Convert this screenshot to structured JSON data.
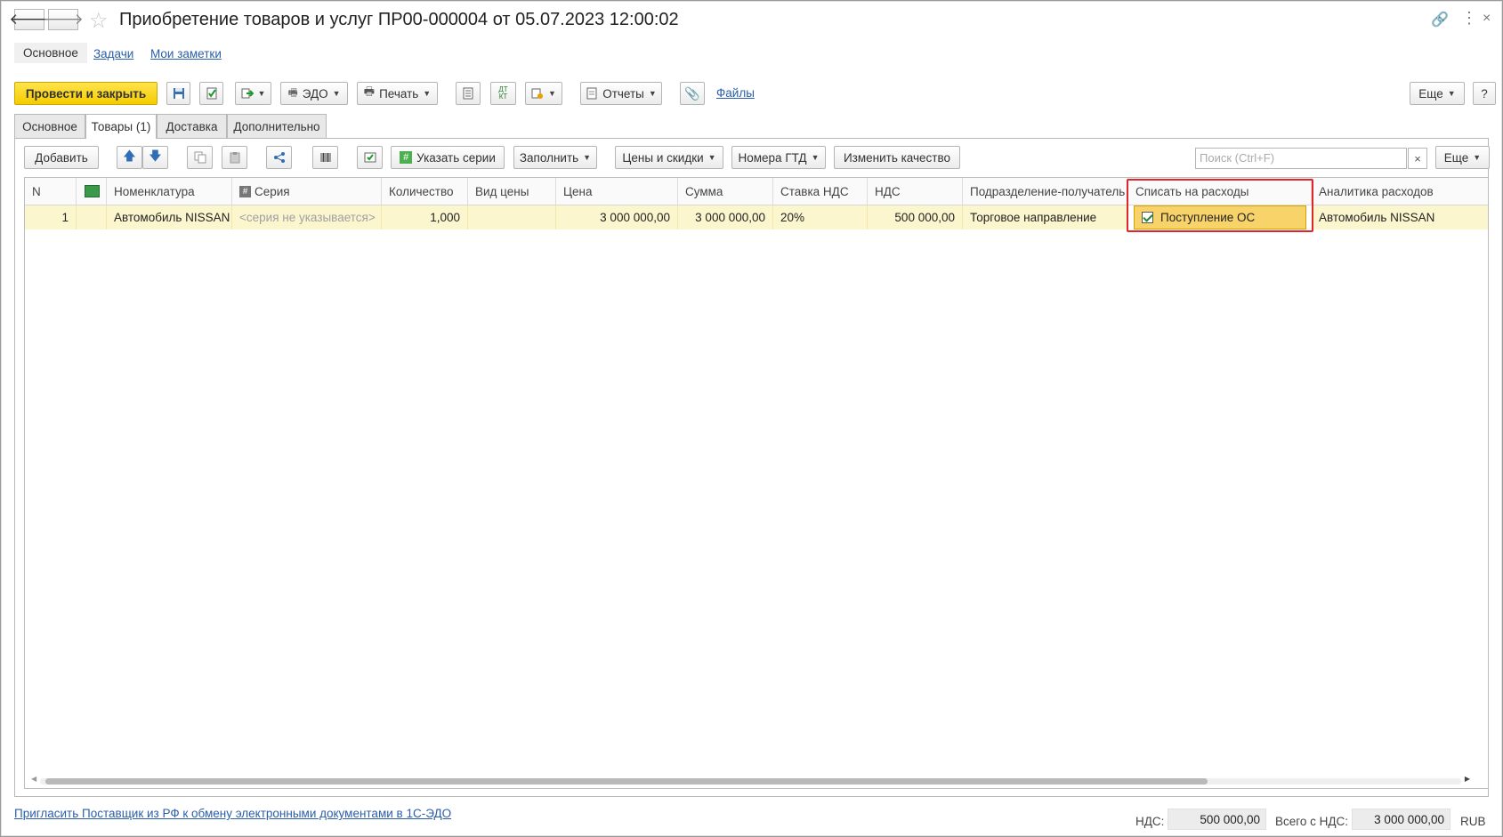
{
  "window": {
    "title": "Приобретение товаров и услуг ПР00-000004 от 05.07.2023 12:00:02"
  },
  "sections": [
    {
      "label": "Основное",
      "active": true
    },
    {
      "label": "Задачи",
      "active": false
    },
    {
      "label": "Мои заметки",
      "active": false
    }
  ],
  "toolbar": {
    "post_close": "Провести и закрыть",
    "edo": "ЭДО",
    "print": "Печать",
    "reports": "Отчеты",
    "files": "Файлы",
    "more": "Еще",
    "help": "?"
  },
  "tabs": [
    {
      "label": "Основное",
      "active": false
    },
    {
      "label": "Товары (1)",
      "active": true
    },
    {
      "label": "Доставка",
      "active": false
    },
    {
      "label": "Дополнительно",
      "active": false
    }
  ],
  "table_toolbar": {
    "add": "Добавить",
    "set_series": "Указать серии",
    "fill": "Заполнить",
    "prices": "Цены и скидки",
    "gtd": "Номера ГТД",
    "quality": "Изменить качество",
    "search_placeholder": "Поиск (Ctrl+F)",
    "search_clear": "×",
    "more": "Еще"
  },
  "table": {
    "columns": [
      "N",
      "",
      "Номенклатура",
      "Серия",
      "Количество",
      "Вид цены",
      "Цена",
      "Сумма",
      "Ставка НДС",
      "НДС",
      "Подразделение-получатель",
      "Списать на расходы",
      "Аналитика расходов"
    ],
    "rows": [
      {
        "n": "1",
        "nomenclature": "Автомобиль NISSAN",
        "series": "<серия не указывается>",
        "quantity": "1,000",
        "price_type": "",
        "price": "3 000 000,00",
        "sum": "3 000 000,00",
        "vat_rate": "20%",
        "vat": "500 000,00",
        "department": "Торговое направление",
        "write_off": "Поступление ОС",
        "write_off_checked": true,
        "analytics": "Автомобиль NISSAN"
      }
    ]
  },
  "footer": {
    "invite_link": "Пригласить Поставщик из РФ к обмену электронными документами в 1С-ЭДО",
    "vat_label": "НДС:",
    "vat_value": "500 000,00",
    "total_label": "Всего с НДС:",
    "total_value": "3 000 000,00",
    "currency": "RUB"
  },
  "colors": {
    "accent_yellow": "#f5cc00",
    "row_highlight": "#fcf6cf",
    "annotation_red": "#e0262b",
    "link_blue": "#2b5ea8"
  }
}
